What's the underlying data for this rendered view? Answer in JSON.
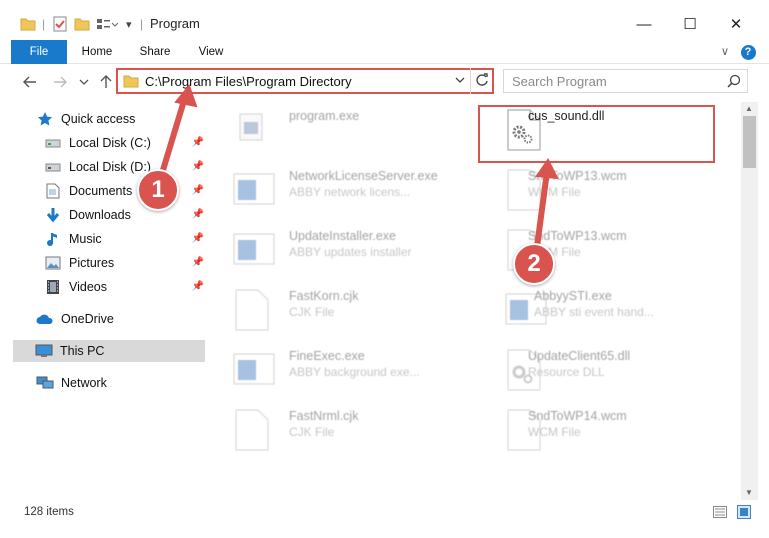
{
  "window": {
    "title": "Program",
    "minimize": "—",
    "maximize": "☐",
    "close": "✕"
  },
  "ribbon": {
    "tabs": [
      "File",
      "Home",
      "Share",
      "View"
    ],
    "expand": "∨",
    "help": "?"
  },
  "address": {
    "path": "C:\\Program Files\\Program Directory",
    "search_placeholder": "Search Program"
  },
  "sidebar": {
    "items": [
      {
        "label": "Quick access",
        "icon": "star-icon",
        "pinned": false
      },
      {
        "label": "Local Disk (C:)",
        "icon": "drive-icon",
        "pinned": true
      },
      {
        "label": "Local Disk (D:)",
        "icon": "drive-icon",
        "pinned": true
      },
      {
        "label": "Documents",
        "icon": "documents-icon",
        "pinned": true
      },
      {
        "label": "Downloads",
        "icon": "downloads-icon",
        "pinned": true
      },
      {
        "label": "Music",
        "icon": "music-icon",
        "pinned": true
      },
      {
        "label": "Pictures",
        "icon": "pictures-icon",
        "pinned": true
      },
      {
        "label": "Videos",
        "icon": "videos-icon",
        "pinned": true
      },
      {
        "label": "OneDrive",
        "icon": "cloud-icon",
        "pinned": false
      },
      {
        "label": "This PC",
        "icon": "pc-icon",
        "pinned": false,
        "selected": true
      },
      {
        "label": "Network",
        "icon": "network-icon",
        "pinned": false
      }
    ]
  },
  "files": [
    {
      "name": "program.exe",
      "type": ""
    },
    {
      "name": "cus_sound.dll",
      "type": ""
    },
    {
      "name": "NetworkLicenseServer.exe",
      "type": "ABBY network licens..."
    },
    {
      "name": "SndToWP13.wcm",
      "type": "WCM File"
    },
    {
      "name": "UpdateInstaller.exe",
      "type": "ABBY updates installer"
    },
    {
      "name": "SndToWP13.wcm",
      "type": "WCM File"
    },
    {
      "name": "FastKorn.cjk",
      "type": "CJK File"
    },
    {
      "name": "AbbyySTI.exe",
      "type": "ABBY sti event hand..."
    },
    {
      "name": "FineExec.exe",
      "type": "ABBY background exe..."
    },
    {
      "name": "UpdateClient65.dll",
      "type": "Resource DLL"
    },
    {
      "name": "FastNrml.cjk",
      "type": "CJK File"
    },
    {
      "name": "SndToWP14.wcm",
      "type": "WCM File"
    }
  ],
  "status": {
    "item_count": "128 items"
  },
  "annotations": {
    "badge1": "1",
    "badge2": "2",
    "color": "#d9534f"
  },
  "colors": {
    "accent": "#1979ca",
    "highlight": "#d9534f",
    "selection": "#d9d9d9"
  }
}
